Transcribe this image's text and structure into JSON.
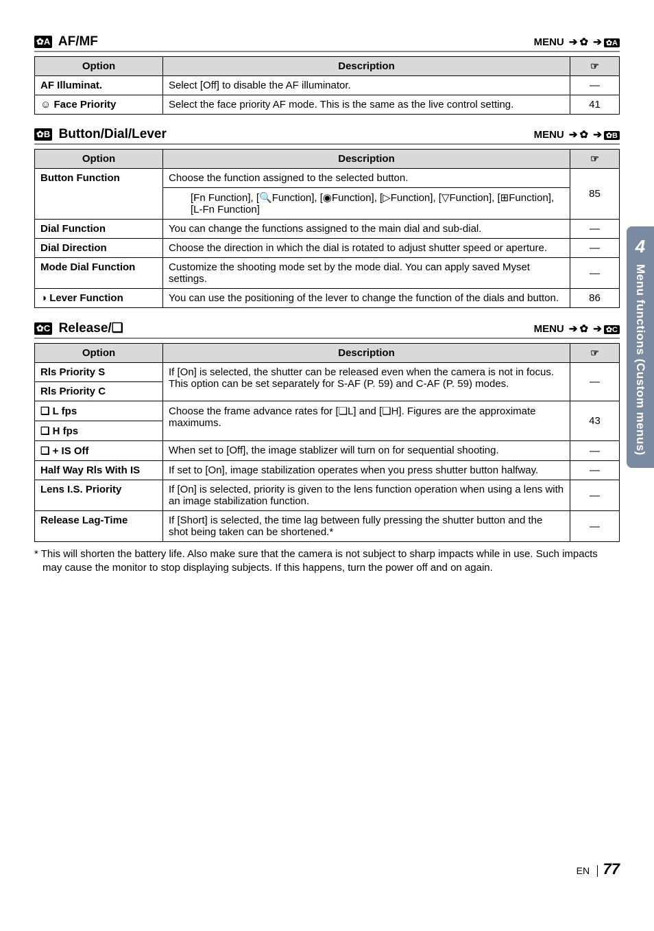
{
  "sidetab": {
    "num": "4",
    "text": "Menu functions (Custom menus)"
  },
  "footer": {
    "lang": "EN",
    "page": "77"
  },
  "sec_af": {
    "icon": "A",
    "title": "AF/MF",
    "menu_label": "MENU",
    "menu_end_icon": "A",
    "th_option": "Option",
    "th_desc": "Description",
    "th_ref": "☞",
    "rows": [
      {
        "opt": "AF Illuminat.",
        "desc": "Select [Off] to disable the AF illuminator.",
        "ref": "—"
      },
      {
        "opt": "☺ Face Priority",
        "desc": "Select the face priority AF mode. This is the same as the live control setting.",
        "ref": "41"
      }
    ]
  },
  "sec_btn": {
    "icon": "B",
    "title": "Button/Dial/Lever",
    "menu_label": "MENU",
    "menu_end_icon": "B",
    "th_option": "Option",
    "th_desc": "Description",
    "th_ref": "☞",
    "rows": {
      "r0": {
        "opt": "Button Function",
        "desc": "Choose the function assigned to the selected button.",
        "ref": ""
      },
      "r0sub": {
        "desc": "[Fn Function], [🔍Function], [◉Function], [▷Function], [▽Function], [⊞Function], [L-Fn Function]",
        "ref": "85"
      },
      "r1": {
        "opt": "Dial Function",
        "desc": "You can change the functions assigned to the main dial and sub-dial.",
        "ref": "—"
      },
      "r2": {
        "opt": "Dial Direction",
        "desc": "Choose the direction in which the dial is rotated to adjust shutter speed or aperture.",
        "ref": "—"
      },
      "r3": {
        "opt": "Mode Dial Function",
        "desc": "Customize the shooting mode set by the mode dial. You can apply saved Myset settings.",
        "ref": "—"
      },
      "r4": {
        "opt": "◑ Lever Function",
        "desc": "You can use the positioning of the lever to change the function of the dials and button.",
        "ref": "86"
      }
    }
  },
  "sec_rel": {
    "icon": "C",
    "title": "Release/❏",
    "menu_label": "MENU",
    "menu_end_icon": "C",
    "th_option": "Option",
    "th_desc": "Description",
    "th_ref": "☞",
    "rows": {
      "r0a": {
        "opt": "Rls Priority S"
      },
      "r0b": {
        "opt": "Rls Priority C"
      },
      "r0desc": "If [On] is selected, the shutter can be released even when the camera is not in focus. This option can be set separately for S-AF (P. 59) and C-AF (P. 59) modes.",
      "r0ref": "—",
      "r1a": {
        "opt": "❏ L fps"
      },
      "r1b": {
        "opt": "❏ H fps"
      },
      "r1desc": "Choose the frame advance rates for [❏L] and [❏H]. Figures are the approximate maximums.",
      "r1ref": "43",
      "r2": {
        "opt": "❏ + IS Off",
        "desc": "When set to [Off], the image stablizer will turn on for sequential shooting.",
        "ref": "—"
      },
      "r3": {
        "opt": "Half Way Rls With IS",
        "desc": "If set to [On], image stabilization operates when you press shutter button halfway.",
        "ref": "—"
      },
      "r4": {
        "opt": "Lens I.S. Priority",
        "desc": "If [On] is selected, priority is given to the lens function operation when using a lens with an image stabilization function.",
        "ref": "—"
      },
      "r5": {
        "opt": "Release Lag-Time",
        "desc": "If [Short] is selected, the time lag between fully pressing the shutter button and the shot being taken can be shortened.*",
        "ref": "—"
      }
    },
    "footnote": "* This will shorten the battery life. Also make sure that the camera is not subject to sharp impacts while in use. Such impacts may cause the monitor to stop displaying subjects. If this happens, turn the power off and on again."
  }
}
